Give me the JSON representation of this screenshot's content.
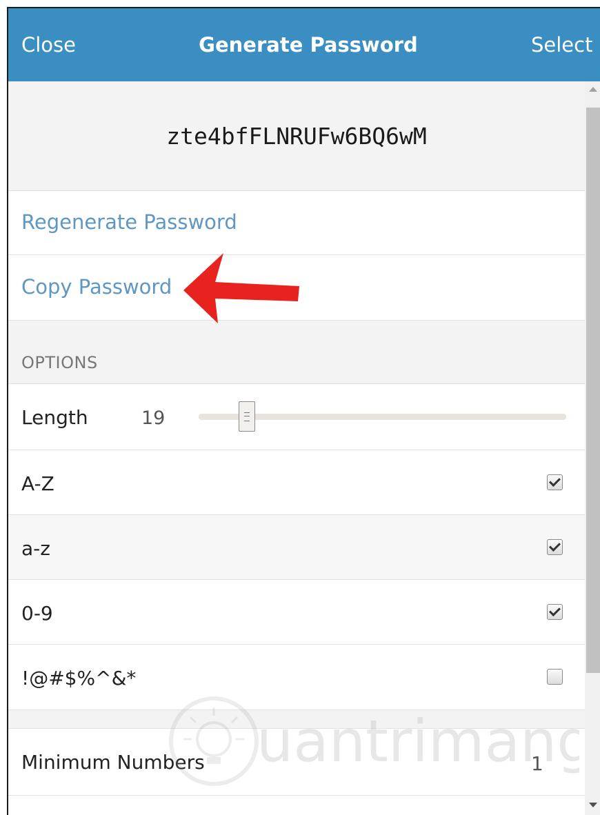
{
  "header": {
    "close_label": "Close",
    "title": "Generate Password",
    "select_label": "Select",
    "background_color": "#3b8ec2"
  },
  "password": {
    "value": "zte4bfFLNRUFw6BQ6wM"
  },
  "actions": {
    "regenerate_label": "Regenerate Password",
    "copy_label": "Copy Password",
    "link_color": "#5f97c4"
  },
  "options": {
    "section_label": "OPTIONS",
    "length": {
      "label": "Length",
      "value": "19",
      "slider_fraction": 0.13
    },
    "charsets": [
      {
        "label": "A-Z",
        "checked": true
      },
      {
        "label": "a-z",
        "checked": true
      },
      {
        "label": "0-9",
        "checked": true
      },
      {
        "label": "!@#$%^&*",
        "checked": false
      }
    ],
    "minimum_numbers": {
      "label": "Minimum Numbers",
      "value": "1"
    }
  },
  "annotation": {
    "arrow_color": "#e8221e"
  },
  "watermark": {
    "text": "uantrimang",
    "icon": "lightbulb-icon"
  }
}
